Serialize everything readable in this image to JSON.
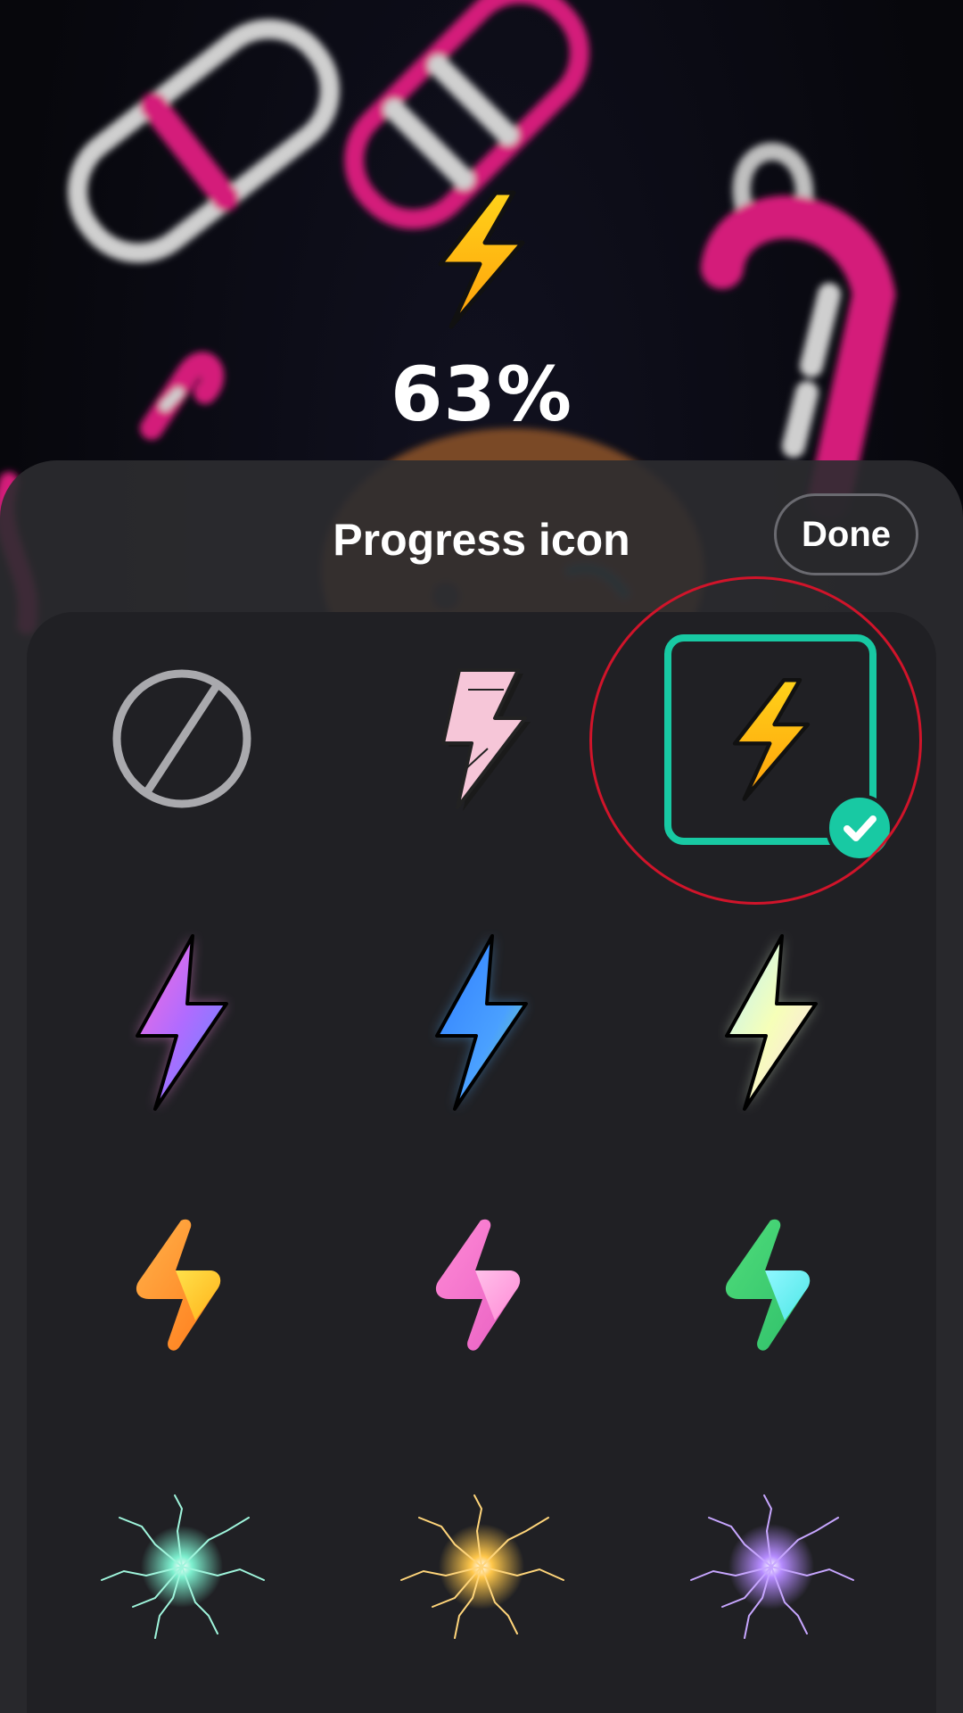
{
  "preview": {
    "battery_percent": "63%",
    "icon": "yellow-lightning-bolt-icon"
  },
  "sheet": {
    "title": "Progress icon",
    "done_label": "Done"
  },
  "icons": [
    {
      "name": "none-icon",
      "selected": false
    },
    {
      "name": "pink-sketch-lightning-icon",
      "selected": false
    },
    {
      "name": "yellow-lightning-bolt-icon",
      "selected": true
    },
    {
      "name": "pink-purple-gradient-lightning-icon",
      "selected": false
    },
    {
      "name": "blue-green-gradient-lightning-icon",
      "selected": false
    },
    {
      "name": "pastel-holographic-lightning-icon",
      "selected": false
    },
    {
      "name": "orange-3d-lightning-icon",
      "selected": false
    },
    {
      "name": "pink-3d-lightning-icon",
      "selected": false
    },
    {
      "name": "green-3d-lightning-icon",
      "selected": false
    },
    {
      "name": "teal-electric-spark-icon",
      "selected": false
    },
    {
      "name": "gold-electric-spark-icon",
      "selected": false
    },
    {
      "name": "purple-electric-spark-icon",
      "selected": false
    }
  ],
  "colors": {
    "accent": "#18c9a3",
    "sheet_background": "#2c2c30",
    "grid_background": "#202024",
    "annotation": "#d0142a",
    "wallpaper_pink": "#d41a7a"
  }
}
